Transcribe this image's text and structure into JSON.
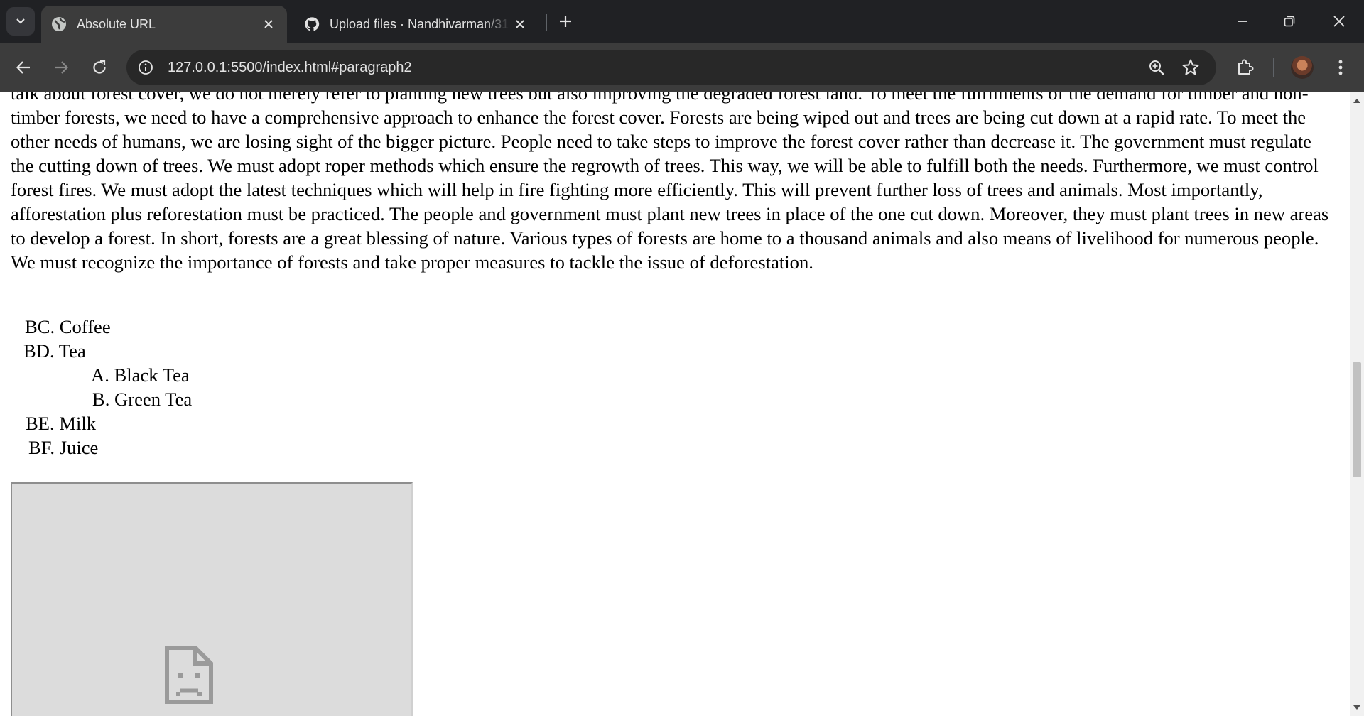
{
  "browser": {
    "tabs": [
      {
        "title": "Absolute URL",
        "active": true,
        "favicon": "globe-icon"
      },
      {
        "title": "Upload files · Nandhivarman/31",
        "active": false,
        "favicon": "github-icon"
      }
    ],
    "address_bar": {
      "url": "127.0.0.1:5500/index.html#paragraph2"
    },
    "toolbar_icons": [
      "back-icon",
      "forward-icon",
      "reload-icon",
      "site-info-icon",
      "zoom-icon",
      "star-icon",
      "extensions-icon",
      "avatar",
      "menu-icon"
    ],
    "window_controls": [
      "minimize-icon",
      "restore-icon",
      "close-icon"
    ]
  },
  "page": {
    "paragraph": "talk about forest cover, we do not merely refer to planting new trees but also improving the degraded forest land. To meet the fulfilments of the demand for timber and non-timber forests, we need to have a comprehensive approach to enhance the forest cover. Forests are being wiped out and trees are being cut down at a rapid rate. To meet the other needs of humans, we are losing sight of the bigger picture. People need to take steps to improve the forest cover rather than decrease it. The government must regulate the cutting down of trees. We must adopt roper methods which ensure the regrowth of trees. This way, we will be able to fulfill both the needs. Furthermore, we must control forest fires. We must adopt the latest techniques which will help in fire fighting more efficiently. This will prevent further loss of trees and animals. Most importantly, afforestation plus reforestation must be practiced. The people and government must plant new trees in place of the one cut down. Moreover, they must plant trees in new areas to develop a forest. In short, forests are a great blessing of nature. Various types of forests are home to a thousand animals and also means of livelihood for numerous people. We must recognize the importance of forests and take proper measures to tackle the issue of deforestation.",
    "list": {
      "items": [
        {
          "marker": "BC.",
          "text": "Coffee"
        },
        {
          "marker": "BD.",
          "text": "Tea",
          "children": [
            {
              "marker": "A.",
              "text": "Black Tea"
            },
            {
              "marker": "B.",
              "text": "Green Tea"
            }
          ]
        },
        {
          "marker": "BE.",
          "text": "Milk"
        },
        {
          "marker": "BF.",
          "text": "Juice"
        }
      ]
    },
    "embedded_frame": {
      "state": "failed-to-load",
      "icon": "sad-page-icon"
    }
  },
  "colors": {
    "titlebar": "#202124",
    "toolbar": "#3c3c3c",
    "omnibox": "#282828",
    "frame_placeholder": "#dcdcdc"
  }
}
